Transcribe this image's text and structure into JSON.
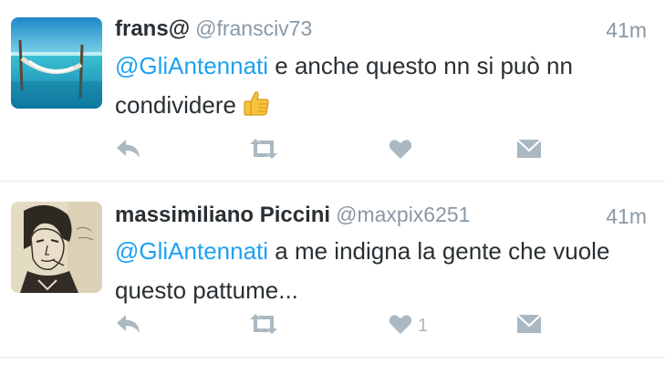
{
  "tweets": [
    {
      "name": "frans@",
      "handle": "@fransciv73",
      "time": "41m",
      "mention": "@GliAntennati",
      "text": " e anche questo nn si può nn condividere",
      "emoji": "thumbs-up",
      "like_count": ""
    },
    {
      "name": "massimiliano Piccini",
      "handle": "@maxpix6251",
      "time": "41m",
      "mention": "@GliAntennati",
      "text": " a me indigna la gente che vuole questo pattume...",
      "like_count": "1"
    }
  ],
  "icons": [
    "reply-icon",
    "retweet-icon",
    "like-icon",
    "direct-message-icon"
  ],
  "colors": {
    "mention": "#1da1f2",
    "muted": "#8899a6",
    "icon": "#aab8c2",
    "divider": "#e1e8ed"
  }
}
